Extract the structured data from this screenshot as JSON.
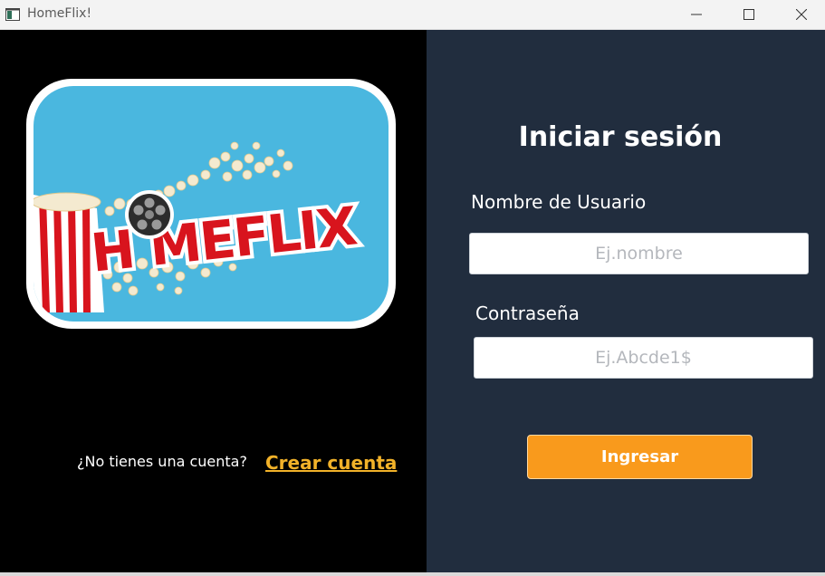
{
  "window": {
    "title": "HomeFlix!",
    "controls": {
      "minimize": "minimize-icon",
      "maximize": "maximize-icon",
      "close": "close-icon"
    }
  },
  "left_panel": {
    "logo_text": "HOMEFLIX",
    "no_account_text": "¿No tienes una cuenta?",
    "create_account_link": "Crear cuenta"
  },
  "right_panel": {
    "title": "Iniciar sesión",
    "username": {
      "label": "Nombre de Usuario",
      "placeholder": "Ej.nombre",
      "value": ""
    },
    "password": {
      "label": "Contraseña",
      "placeholder": "Ej.Abcde1$",
      "value": ""
    },
    "submit_label": "Ingresar"
  },
  "colors": {
    "left_bg": "#000000",
    "right_bg": "#212d3e",
    "link": "#f2b229",
    "button": "#f99a1c",
    "logo_bg": "#4ab7df",
    "logo_red": "#d8141d"
  }
}
